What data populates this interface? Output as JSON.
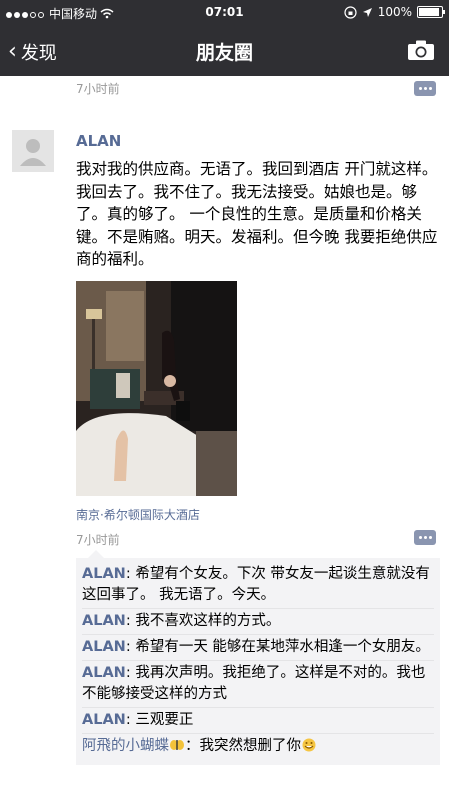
{
  "status_bar": {
    "carrier": "中国移动",
    "time": "07:01",
    "battery": "100%",
    "battery_level": 1.0
  },
  "nav": {
    "back_label": "发现",
    "title": "朋友圈"
  },
  "previous_post": {
    "time": "7小时前"
  },
  "post": {
    "author": "ALAN",
    "text": "我对我的供应商。无语了。我回到酒店 开门就这样。我回去了。我不住了。我无法接受。姑娘也是。够了。真的够了。 一个良性的生意。是质量和价格关键。不是贿赂。明天。发福利。但今晚 我要拒绝供应商的福利。",
    "location": "南京·希尔顿国际大酒店",
    "time": "7小时前"
  },
  "comments": [
    {
      "author": "ALAN",
      "sep": ": ",
      "text": "希望有个女友。下次 带女友一起谈生意就没有这回事了。 我无语了。今天。"
    },
    {
      "author": "ALAN",
      "sep": ": ",
      "text": "我不喜欢这样的方式。"
    },
    {
      "author": "ALAN",
      "sep": ": ",
      "text": "希望有一天 能够在某地萍水相逢一个女朋友。"
    },
    {
      "author": "ALAN",
      "sep": ": ",
      "text": "我再次声明。我拒绝了。这样是不对的。我也不能够接受这样的方式"
    },
    {
      "author": "ALAN",
      "sep": ": ",
      "text": "三观要正"
    },
    {
      "author": "阿飛的小蝴蝶",
      "sep": "：",
      "text": "我突然想删了你"
    }
  ],
  "colors": {
    "link": "#576b95",
    "navbar": "#2f2f33",
    "comment_bg": "#f3f3f5"
  },
  "icons": [
    "signal-dots-icon",
    "wifi-icon",
    "lock-rotation-icon",
    "location-arrow-icon",
    "battery-icon",
    "back-chevron-icon",
    "camera-icon",
    "comment-icon",
    "butterfly-emoji-icon",
    "laugh-emoji-icon"
  ]
}
